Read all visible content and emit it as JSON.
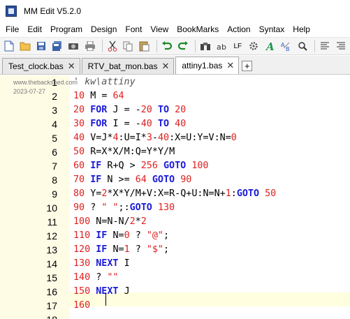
{
  "window": {
    "title": "MM Edit V5.2.0"
  },
  "menu": [
    "File",
    "Edit",
    "Program",
    "Design",
    "Font",
    "View",
    "BookMarks",
    "Action",
    "Syntax",
    "Help"
  ],
  "toolbar": {
    "buttons": [
      "new-file-icon",
      "open-folder-icon",
      "save-icon",
      "save-all-icon",
      "camera-icon",
      "print-icon",
      "cut-icon",
      "copy-icon",
      "paste-icon",
      "undo-icon",
      "redo-icon",
      "find-icon",
      "text-case-icon",
      "line-ending-icon",
      "gear-icon",
      "format-icon",
      "replace-icon",
      "zoom-icon",
      "align-icon",
      "list-icon"
    ],
    "lf_label": "LF"
  },
  "tabs": [
    {
      "label": "Test_clock.bas",
      "active": false
    },
    {
      "label": "RTV_bat_mon.bas",
      "active": false
    },
    {
      "label": "attiny1.bas",
      "active": true
    }
  ],
  "watermark": {
    "site": "www.thebackshed.com",
    "date": "2023-07-27"
  },
  "editor": {
    "line_numbers": [
      "1",
      "2",
      "3",
      "4",
      "5",
      "6",
      "7",
      "8",
      "9",
      "10",
      "11",
      "12",
      "13",
      "14",
      "15",
      "16",
      "17",
      "18"
    ],
    "current_line": 17,
    "lines": [
      "' kw\\attiny",
      "10 M = 64",
      "20 FOR J = -20 TO 20",
      "30 FOR I = -40 TO 40",
      "40 V=J*4:U=I*3-40:X=U:Y=V:N=0",
      "50 R=X*X/M:Q=Y*Y/M",
      "60 IF R+Q > 256 GOTO 100",
      "70 IF N >= 64 GOTO 90",
      "80 Y=2*X*Y/M+V:X=R-Q+U:N=N+1:GOTO 50",
      "90 ? \" \";:GOTO 130",
      "100 N=N-N/2*2",
      "110 IF N=0 ? \"@\";",
      "120 IF N=1 ? \"$\";",
      "130 NEXT I",
      "140 ? \"\"",
      "150 NEXT J",
      "160",
      ""
    ]
  }
}
